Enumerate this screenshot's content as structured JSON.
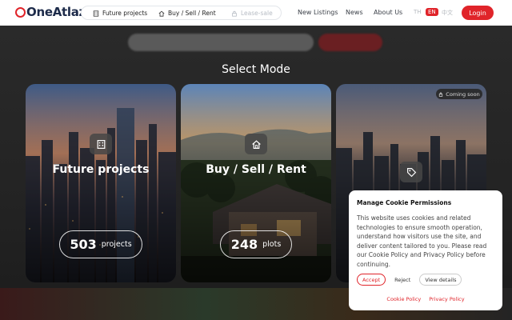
{
  "header": {
    "logo": "OneAtlaz",
    "modes": [
      {
        "label": "Future projects",
        "icon": "building-icon",
        "enabled": true
      },
      {
        "label": "Buy / Sell / Rent",
        "icon": "home-icon",
        "enabled": true
      },
      {
        "label": "Lease-sale",
        "icon": "lock-icon",
        "enabled": false
      }
    ],
    "nav": [
      "New Listings",
      "News",
      "About Us"
    ],
    "languages": [
      "TH",
      "EN",
      "中文"
    ],
    "active_language": "EN",
    "login_label": "Login"
  },
  "main": {
    "title": "Select Mode",
    "cards": [
      {
        "title": "Future projects",
        "icon": "building-icon",
        "count": "503",
        "unit": "projects"
      },
      {
        "title": "Buy / Sell / Rent",
        "icon": "home-icon",
        "count": "248",
        "unit": "plots"
      },
      {
        "title": "",
        "icon": "tag-icon",
        "badge": "Coming soon"
      }
    ]
  },
  "cookie": {
    "title": "Manage Cookie Permissions",
    "body": "This website uses cookies and related technologies to ensure smooth operation, understand how visitors use the site, and deliver content tailored to you. Please read our Cookie Policy and Privacy Policy before continuing.",
    "accept": "Accept",
    "reject": "Reject",
    "view": "View details",
    "links": [
      "Cookie Policy",
      "Privacy Policy"
    ]
  },
  "colors": {
    "accent": "#e0242a",
    "navy": "#1d2b4a"
  }
}
